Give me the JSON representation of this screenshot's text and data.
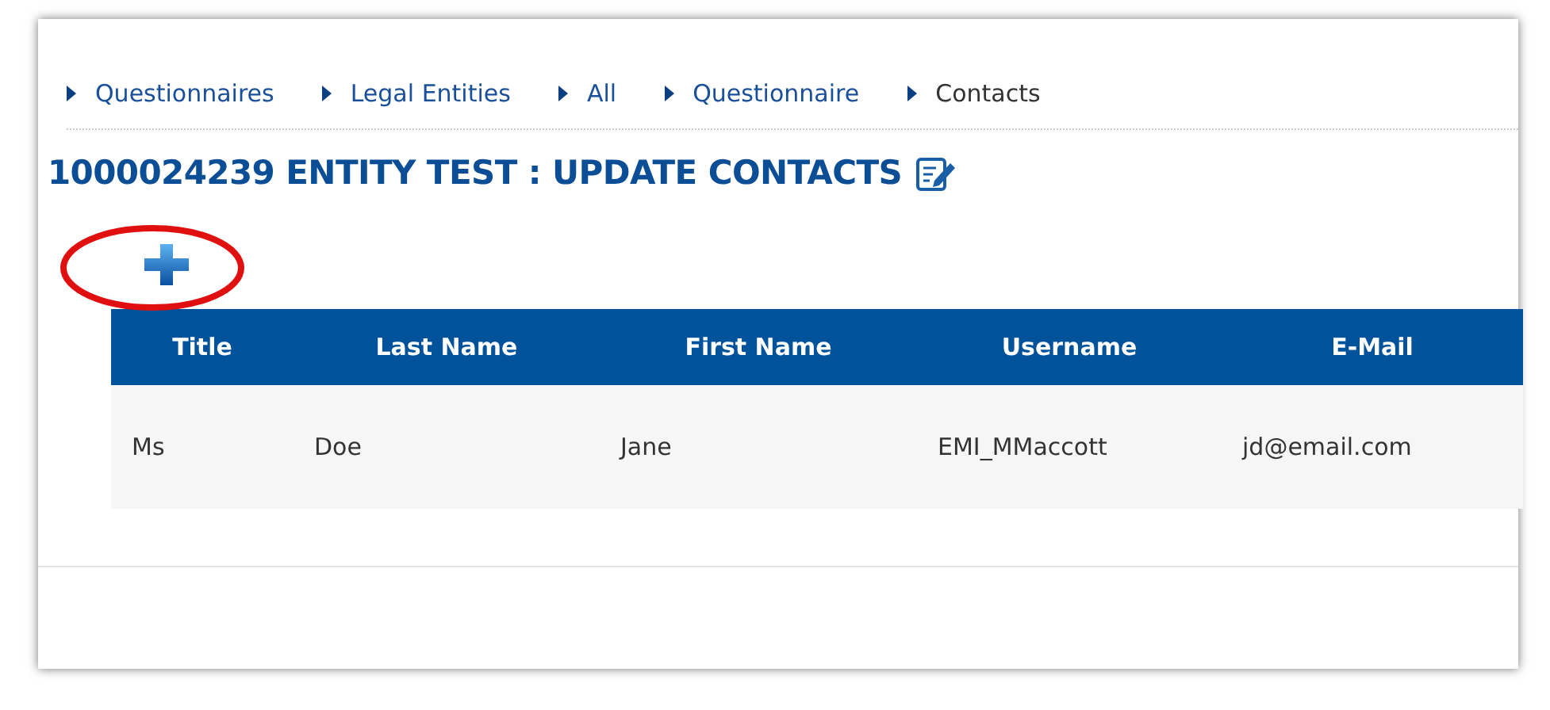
{
  "breadcrumbs": [
    {
      "label": "Questionnaires"
    },
    {
      "label": "Legal Entities"
    },
    {
      "label": "All"
    },
    {
      "label": "Questionnaire"
    },
    {
      "label": "Contacts"
    }
  ],
  "page_title": "1000024239 ENTITY TEST : UPDATE CONTACTS",
  "table": {
    "columns": [
      "Title",
      "Last Name",
      "First Name",
      "Username",
      "E-Mail"
    ],
    "rows": [
      [
        "Ms",
        "Doe",
        "Jane",
        "EMI_MMaccott",
        "jd@email.com"
      ]
    ]
  }
}
